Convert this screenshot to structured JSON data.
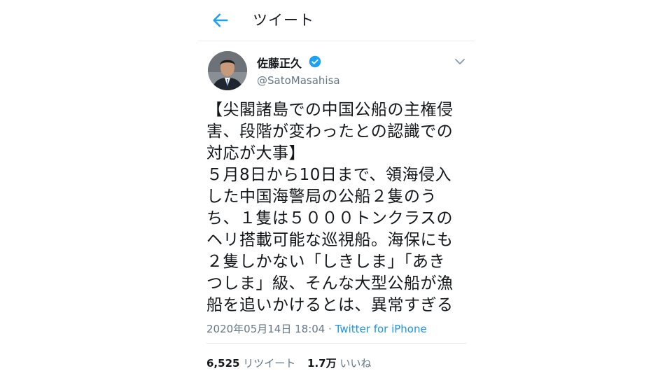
{
  "header": {
    "title": "ツイート"
  },
  "user": {
    "name": "佐藤正久",
    "handle": "@SatoMasahisa"
  },
  "tweet": {
    "text": "【尖閣諸島での中国公船の主権侵\n害、段階が変わったとの認識での\n対応が大事】\n５月8日から10日まで、領海侵入\nした中国海警局の公船２隻のう\nち、１隻は５０００トンクラスの\nヘリ搭載可能な巡視船。海保にも\n２隻しかない「しきしま」「あき\nつしま」級、そんな大型公船が漁\n船を追いかけるとは、異常すぎる",
    "timestamp": "2020年05月14日 18:04",
    "separator": " · ",
    "source": "Twitter for iPhone"
  },
  "stats": {
    "retweets_count": "6,525",
    "retweets_label": "リツイート",
    "likes_count": "1.7万",
    "likes_label": "いいね"
  },
  "colors": {
    "accent": "#1da1f2",
    "text": "#14171a",
    "muted": "#657786"
  }
}
